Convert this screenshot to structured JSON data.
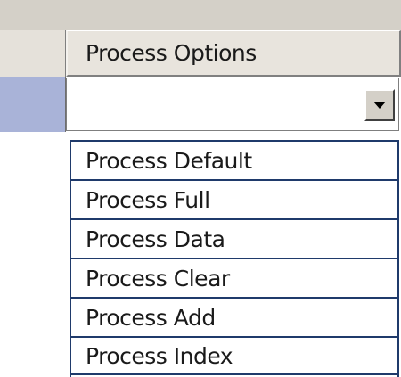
{
  "grid": {
    "column_header": "Process Options",
    "selected_value": ""
  },
  "dropdown": {
    "options": [
      "Process Default",
      "Process Full",
      "Process Data",
      "Process Clear",
      "Process Add",
      "Process Index"
    ]
  },
  "colors": {
    "row_selector": "#a9b3d8",
    "option_border": "#1f3a6b",
    "chrome": "#d4d0c8"
  },
  "icons": {
    "combo_button": "chevron-down-icon"
  }
}
